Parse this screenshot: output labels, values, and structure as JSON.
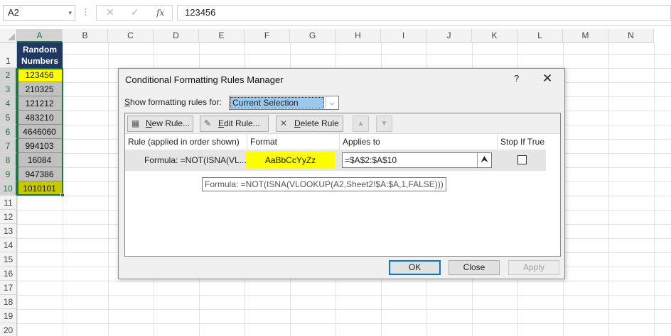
{
  "formula_bar": {
    "name_box": "A2",
    "name_box_caret": "▾",
    "dots": "⋮",
    "cancel_glyph": "✕",
    "enter_glyph": "✓",
    "fx_label": "fx",
    "formula": "123456"
  },
  "columns": [
    "A",
    "B",
    "C",
    "D",
    "E",
    "F",
    "G",
    "H",
    "I",
    "J",
    "K",
    "L",
    "M",
    "N"
  ],
  "rows": [
    "1",
    "2",
    "3",
    "4",
    "5",
    "6",
    "7",
    "8",
    "9",
    "10",
    "11",
    "12",
    "13",
    "14",
    "15",
    "16",
    "17",
    "18",
    "19",
    "20"
  ],
  "sheet": {
    "header_line1": "Random",
    "header_line2": "Numbers",
    "values": [
      "123456",
      "210325",
      "121212",
      "483210",
      "4646060",
      "994103",
      "16084",
      "947386",
      "1010101"
    ],
    "colors": {
      "header_bg": "#1f3864",
      "highlight_yellow": "#ffff00",
      "highlight_olive": "#c8c800",
      "gray": "#c0c0c0",
      "selection": "#217346"
    }
  },
  "dialog": {
    "title": "Conditional Formatting Rules Manager",
    "help": "?",
    "close": "✕",
    "show_label": "Show formatting rules for:",
    "show_value": "Current Selection",
    "show_dropdown_icon": "⌵",
    "buttons": {
      "new_rule": "New Rule...",
      "edit_rule": "Edit Rule...",
      "delete_rule": "Delete Rule",
      "move_up": "▲",
      "move_down": "▼",
      "ok": "OK",
      "close": "Close",
      "apply": "Apply"
    },
    "icons": {
      "new_rule": "▦",
      "edit_rule": "✎",
      "delete_rule": "✕",
      "applies_collapse": "⮝"
    },
    "columns": {
      "rule": "Rule (applied in order shown)",
      "format": "Format",
      "applies_to": "Applies to",
      "stop_if_true": "Stop If True"
    },
    "rule": {
      "formula": "Formula: =NOT(ISNA(VL...",
      "preview": "AaBbCcYyZz",
      "applies_to": "=$A$2:$A$10",
      "stop_if_true": false
    },
    "tooltip": "Formula: =NOT(ISNA(VLOOKUP(A2,Sheet2!$A:$A,1,FALSE)))"
  }
}
